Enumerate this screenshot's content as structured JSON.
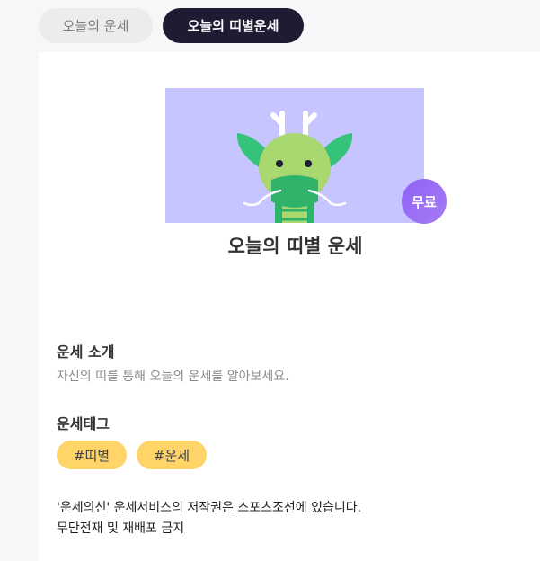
{
  "tabs": [
    {
      "label": "오늘의 운세",
      "active": false
    },
    {
      "label": "오늘의 띠별운세",
      "active": true
    }
  ],
  "card": {
    "badge": "무료",
    "title": "오늘의 띠별 운세",
    "intro": {
      "heading": "운세 소개",
      "text": "자신의 띠를 통해 오늘의 운세를 알아보세요."
    },
    "tags": {
      "heading": "운세태그",
      "items": [
        "#띠별",
        "#운세"
      ]
    },
    "copyright": {
      "line1": "'운세의신' 운세서비스의 저작권은 스포츠조선에 있습니다.",
      "line2": "무단전재 및 재배포 금지"
    }
  },
  "colors": {
    "active_tab": "#1e1b33",
    "hero_bg": "#c6c5ff",
    "badge": "#8d63f5",
    "tag_bg": "#ffd56a"
  }
}
